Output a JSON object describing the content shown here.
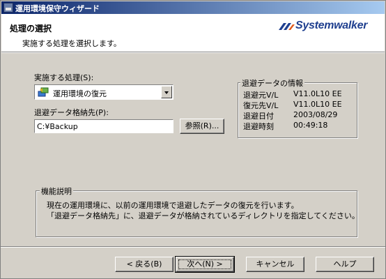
{
  "window": {
    "title": "運用環境保守ウィザード"
  },
  "header": {
    "title": "処理の選択",
    "subtitle": "実施する処理を選択します。",
    "logo_text": "Systemwalker",
    "logo_color": "#1f3f8f"
  },
  "process": {
    "label": "実施する処理(S):",
    "selected": "運用環境の復元",
    "icon": "restore-icon"
  },
  "backup": {
    "label": "退避データ格納先(P):",
    "value": "C:¥Backup",
    "browse_label": "参照(R)..."
  },
  "info": {
    "title": "退避データの情報",
    "rows": [
      {
        "key": "退避元V/L",
        "value": "V11.0L10 EE"
      },
      {
        "key": "復元先V/L",
        "value": "V11.0L10 EE"
      },
      {
        "key": "退避日付",
        "value": "2003/08/29"
      },
      {
        "key": "退避時刻",
        "value": "00:49:18"
      }
    ]
  },
  "description": {
    "title": "機能説明",
    "line1": "現在の運用環境に、以前の運用環境で退避したデータの復元を行います。",
    "line2": "「退避データ格納先」に、退避データが格納されているディレクトリを指定してください。"
  },
  "buttons": {
    "back": "< 戻る(B)",
    "next": "次へ(N) >",
    "cancel": "キャンセル",
    "help": "ヘルプ"
  },
  "colors": {
    "title_gradient_start": "#0a246a",
    "title_gradient_end": "#a6caf0",
    "face": "#d4d0c8"
  }
}
